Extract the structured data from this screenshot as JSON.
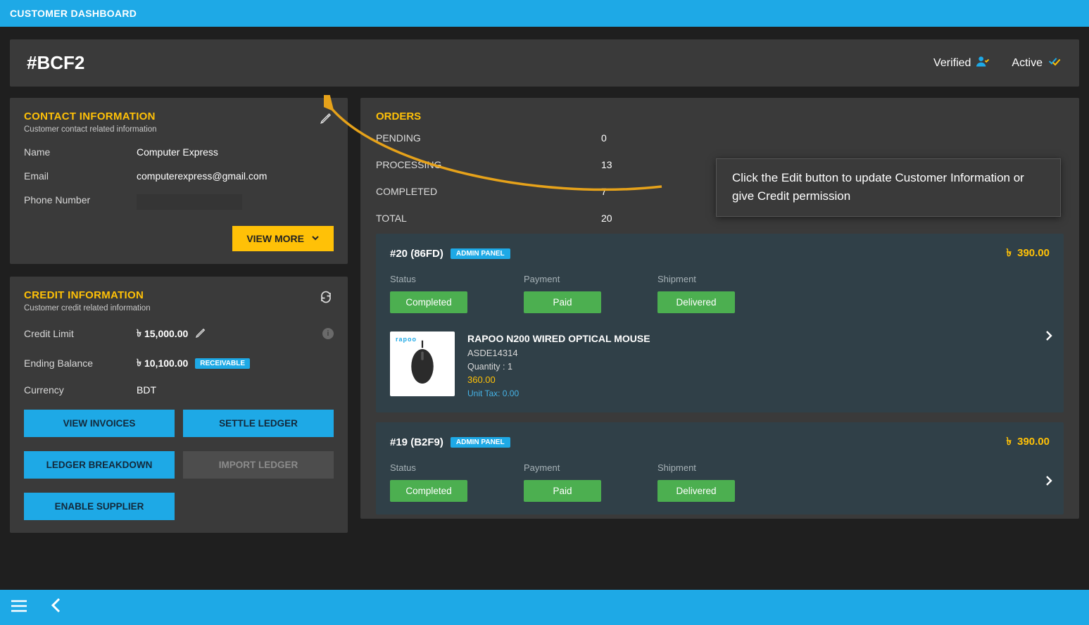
{
  "topbar": {
    "title": "CUSTOMER DASHBOARD"
  },
  "header": {
    "code": "#BCF2",
    "verified_label": "Verified",
    "active_label": "Active"
  },
  "contact": {
    "title": "CONTACT INFORMATION",
    "subtitle": "Customer contact related information",
    "name_label": "Name",
    "name": "Computer Express",
    "email_label": "Email",
    "email": "computerexpress@gmail.com",
    "phone_label": "Phone Number",
    "phone": "",
    "view_more": "VIEW MORE"
  },
  "credit": {
    "title": "CREDIT INFORMATION",
    "subtitle": "Customer credit related information",
    "limit_label": "Credit Limit",
    "limit_value": "15,000.00",
    "balance_label": "Ending Balance",
    "balance_value": "10,100.00",
    "receivable_tag": "RECEIVABLE",
    "currency_label": "Currency",
    "currency_value": "BDT",
    "buttons": {
      "view_invoices": "VIEW INVOICES",
      "settle_ledger": "SETTLE LEDGER",
      "ledger_breakdown": "LEDGER BREAKDOWN",
      "import_ledger": "IMPORT LEDGER",
      "enable_supplier": "ENABLE SUPPLIER"
    }
  },
  "orders": {
    "title": "ORDERS",
    "stats": {
      "pending_label": "PENDING",
      "pending": "0",
      "processing_label": "PROCESSING",
      "processing": "13",
      "completed_label": "COMPLETED",
      "completed": "7",
      "total_label": "TOTAL",
      "total": "20"
    },
    "labels": {
      "status": "Status",
      "payment": "Payment",
      "shipment": "Shipment"
    },
    "admin_panel": "ADMIN PANEL",
    "currency_glyph": "৳",
    "cards": [
      {
        "title": "#20 (86FD)",
        "price": "390.00",
        "status": "Completed",
        "payment": "Paid",
        "shipment": "Delivered",
        "product": {
          "brand": "rapoo",
          "name": "RAPOO N200 WIRED OPTICAL MOUSE",
          "sku": "ASDE14314",
          "qty_label": "Quantity : 1",
          "price": "360.00",
          "tax": "Unit Tax: 0.00"
        }
      },
      {
        "title": "#19 (B2F9)",
        "price": "390.00",
        "status": "Completed",
        "payment": "Paid",
        "shipment": "Delivered"
      }
    ]
  },
  "annotation": {
    "text": "Click the Edit button to update Customer Information or give Credit permission"
  }
}
